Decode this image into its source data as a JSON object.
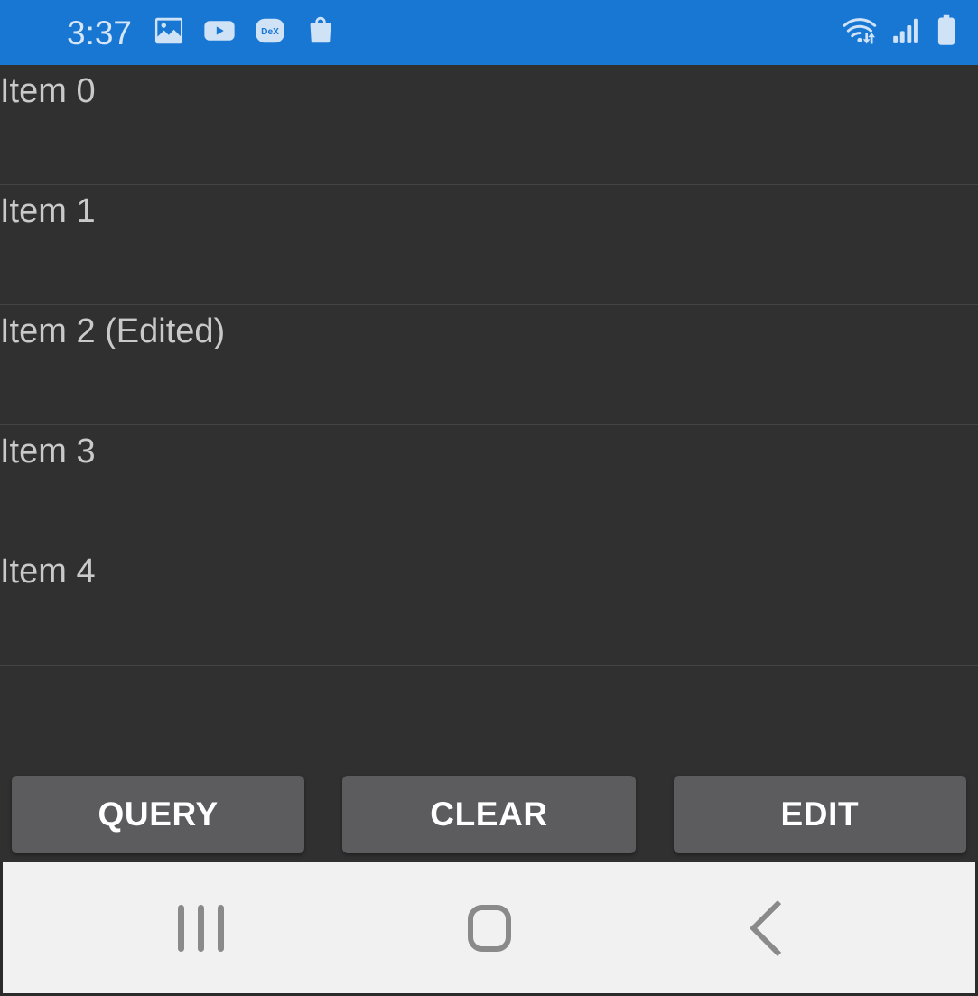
{
  "status_bar": {
    "clock": "3:37",
    "background_color": "#1977D4",
    "icon_color": "#CFE2F6",
    "left_icons": [
      {
        "name": "gallery-icon",
        "label": "Gallery"
      },
      {
        "name": "youtube-icon",
        "label": "YouTube"
      },
      {
        "name": "dex-icon",
        "label": "DeX"
      },
      {
        "name": "shopping-bag-icon",
        "label": "Galaxy Store"
      }
    ],
    "right_icons": [
      {
        "name": "wifi-transfer-icon",
        "label": "Wi-Fi data transfer"
      },
      {
        "name": "cellular-signal-icon",
        "label": "Signal strength"
      },
      {
        "name": "battery-full-icon",
        "label": "Battery full"
      }
    ]
  },
  "list": {
    "background_color": "#303030",
    "text_color": "#C9C9C9",
    "divider_color": "#454545",
    "items": [
      {
        "label": "Item 0"
      },
      {
        "label": "Item 1"
      },
      {
        "label": "Item 2 (Edited)"
      },
      {
        "label": "Item 3"
      },
      {
        "label": "Item 4"
      }
    ]
  },
  "button_bar": {
    "button_color": "#5C5C5E",
    "button_text_color": "#FFFFFF",
    "buttons": [
      {
        "name": "query-button",
        "label": "QUERY"
      },
      {
        "name": "clear-button",
        "label": "CLEAR"
      },
      {
        "name": "edit-button",
        "label": "EDIT"
      }
    ]
  },
  "nav_bar": {
    "background_color": "#F1F1F1",
    "icon_color": "#8A8A8A",
    "buttons": [
      {
        "name": "recents-button",
        "label": "Recents"
      },
      {
        "name": "home-button",
        "label": "Home"
      },
      {
        "name": "back-button",
        "label": "Back"
      }
    ]
  }
}
